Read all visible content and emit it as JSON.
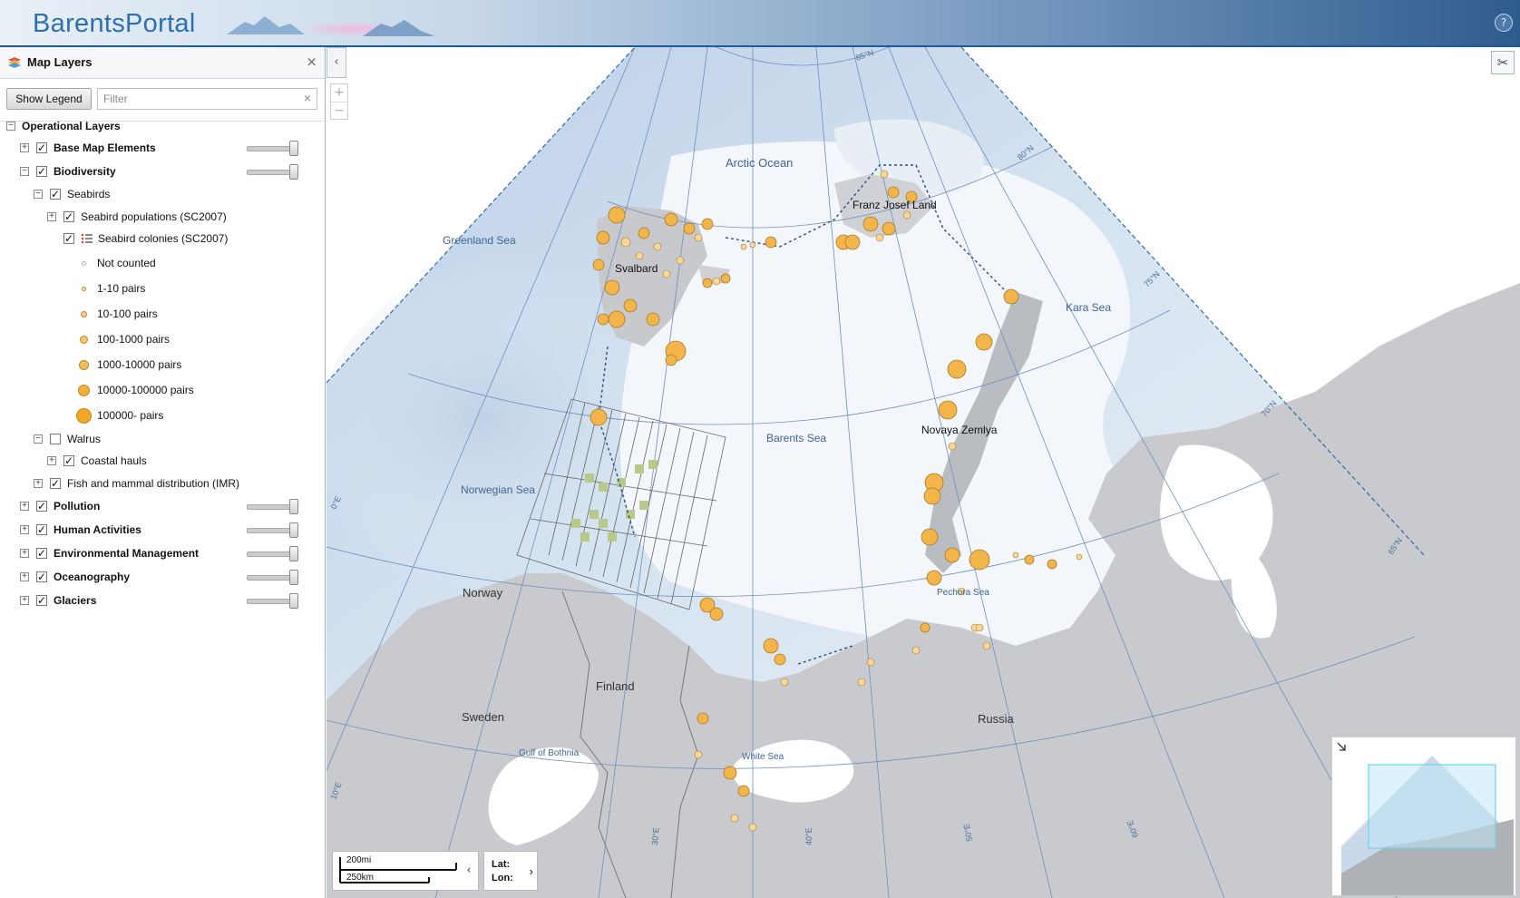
{
  "app": {
    "title": "BarentsPortal",
    "help_label": "?"
  },
  "panel": {
    "title": "Map Layers",
    "close_label": "×",
    "show_legend_label": "Show Legend",
    "filter_placeholder": "Filter",
    "filter_clear": "×",
    "collapse_label": "‹"
  },
  "tree": {
    "operational_layers": "Operational Layers",
    "base_map_elements": "Base Map Elements",
    "biodiversity": "Biodiversity",
    "seabirds": "Seabirds",
    "seabird_populations": "Seabird populations (SC2007)",
    "seabird_colonies": "Seabird colonies (SC2007)",
    "legend": [
      "Not counted",
      "1-10 pairs",
      "10-100 pairs",
      "100-1000 pairs",
      "1000-10000 pairs",
      "10000-100000 pairs",
      "100000- pairs"
    ],
    "walrus": "Walrus",
    "coastal_hauls": "Coastal hauls",
    "fish_mammal": "Fish and mammal distribution (IMR)",
    "pollution": "Pollution",
    "human_activities": "Human Activities",
    "environmental_management": "Environmental Management",
    "oceanography": "Oceanography",
    "glaciers": "Glaciers"
  },
  "map": {
    "zoom_in": "+",
    "zoom_out": "−",
    "labels": {
      "arctic_ocean": "Arctic Ocean",
      "greenland_sea": "Greenland Sea",
      "franz_josef_land": "Franz Josef Land",
      "svalbard": "Svalbard",
      "kara_sea": "Kara Sea",
      "barents_sea": "Barents Sea",
      "novaya_zemlya": "Novaya Zemlya",
      "norwegian_sea": "Norwegian Sea",
      "norway": "Norway",
      "pechora_sea": "Pechora Sea",
      "finland": "Finland",
      "sweden": "Sweden",
      "russia": "Russia",
      "gulf_of_bothnia": "Gulf of Bothnia",
      "white_sea": "White Sea"
    },
    "graticule": {
      "lat85": "85°N",
      "lat80": "80°N",
      "lat75": "75°N",
      "lat70": "70°N",
      "lat65": "65°N",
      "lon0": "0°E",
      "lon10": "10°E",
      "lon30": "30°E",
      "lon40": "40°E",
      "lon50": "50°E",
      "lon60": "60°E"
    },
    "scale": {
      "miles": "200mi",
      "km": "250km"
    },
    "coords": {
      "lat_label": "Lat:",
      "lon_label": "Lon:"
    }
  }
}
